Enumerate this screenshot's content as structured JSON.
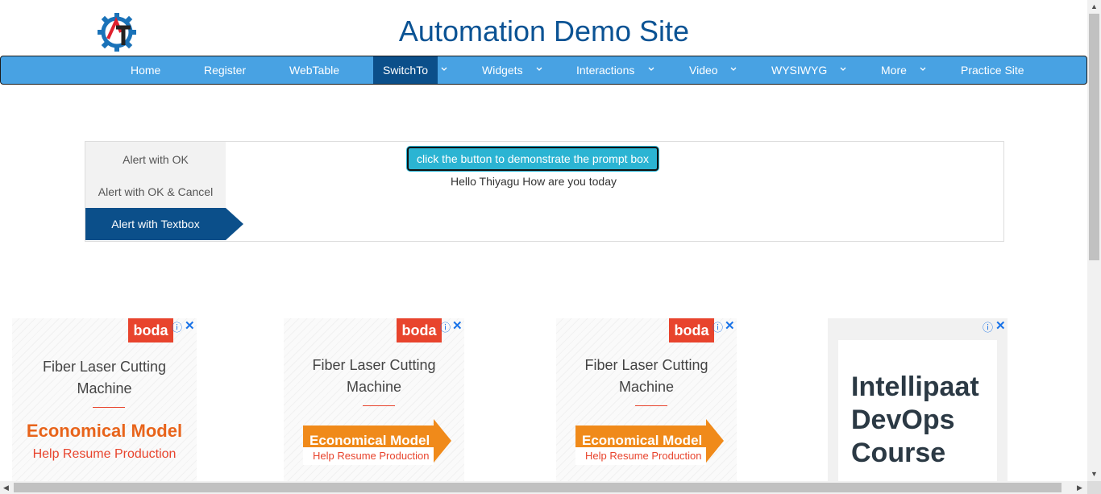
{
  "header": {
    "title": "Automation Demo Site"
  },
  "nav": {
    "items": [
      {
        "label": "Home",
        "dropdown": false,
        "active": false
      },
      {
        "label": "Register",
        "dropdown": false,
        "active": false
      },
      {
        "label": "WebTable",
        "dropdown": false,
        "active": false
      },
      {
        "label": "SwitchTo",
        "dropdown": true,
        "active": true
      },
      {
        "label": "Widgets",
        "dropdown": true,
        "active": false
      },
      {
        "label": "Interactions",
        "dropdown": true,
        "active": false
      },
      {
        "label": "Video",
        "dropdown": true,
        "active": false
      },
      {
        "label": "WYSIWYG",
        "dropdown": true,
        "active": false
      },
      {
        "label": "More",
        "dropdown": true,
        "active": false
      },
      {
        "label": "Practice Site",
        "dropdown": false,
        "active": false
      }
    ]
  },
  "alert_tabs": [
    {
      "label": "Alert with OK",
      "active": false
    },
    {
      "label": "Alert with OK & Cancel",
      "active": false
    },
    {
      "label": "Alert with Textbox",
      "active": true
    }
  ],
  "prompt": {
    "button_label": "click the button to demonstrate the prompt box",
    "result_text": "Hello Thiyagu How are you today"
  },
  "ads": [
    {
      "brand": "boda",
      "headline_1": "Fiber Laser Cutting",
      "headline_2": "Machine",
      "offer": "Economical Model",
      "sub": "Help Resume Production"
    },
    {
      "brand": "boda",
      "headline_1": "Fiber Laser Cutting",
      "headline_2": "Machine",
      "offer": "Economical Model",
      "sub": "Help Resume Production"
    },
    {
      "brand": "boda",
      "headline_1": "Fiber Laser Cutting",
      "headline_2": "Machine",
      "offer": "Economical Model",
      "sub": "Help Resume Production"
    }
  ],
  "ad_course": {
    "text": "Intellipaat DevOps Course"
  },
  "colors": {
    "brand_blue": "#0b5394",
    "nav_bg": "#48a2e3",
    "active_bg": "#0b4f8a",
    "button_bg": "#2bb4d3",
    "ad_orange": "#f08a1a"
  },
  "icons": {
    "ad_info": "ⓘ",
    "ad_close": "✕"
  }
}
